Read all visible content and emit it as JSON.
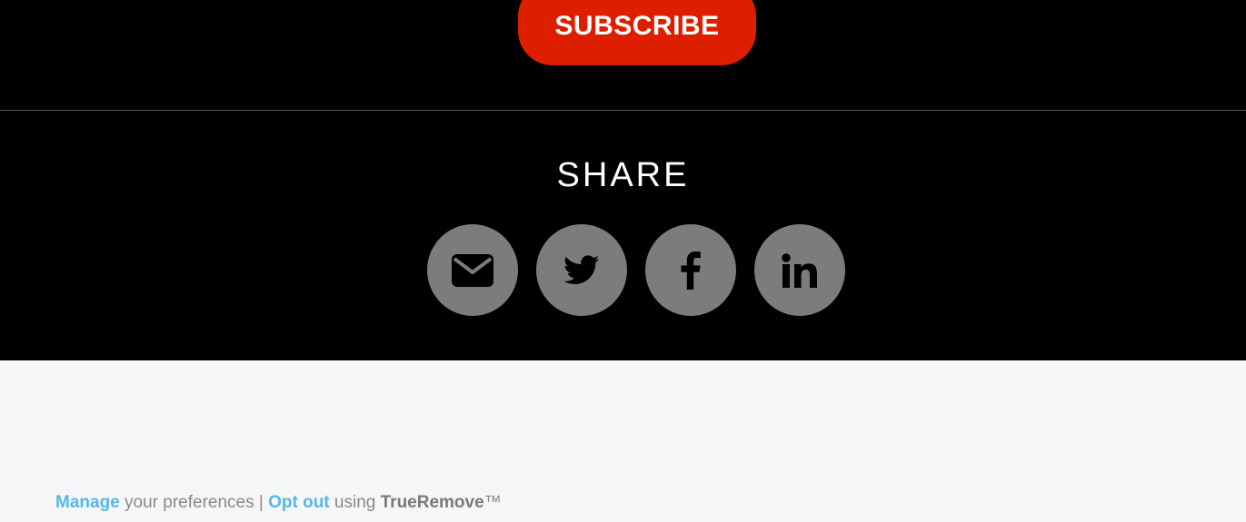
{
  "subscribe": {
    "label": "SUBSCRIBE"
  },
  "share": {
    "title": "SHARE",
    "buttons": [
      {
        "icon": "email-icon"
      },
      {
        "icon": "twitter-icon"
      },
      {
        "icon": "facebook-icon"
      },
      {
        "icon": "linkedin-icon"
      }
    ]
  },
  "footer": {
    "manage_link": "Manage",
    "manage_text": " your preferences | ",
    "optout_link": "Opt out",
    "optout_text": " using ",
    "brand": "TrueRemove",
    "trademark": "™"
  },
  "colors": {
    "dark_bg": "#000000",
    "subscribe_bg": "#dd1f00",
    "icon_circle": "#7c7c7a",
    "footer_bg": "#f5f6f8",
    "link": "#56b8e6"
  }
}
